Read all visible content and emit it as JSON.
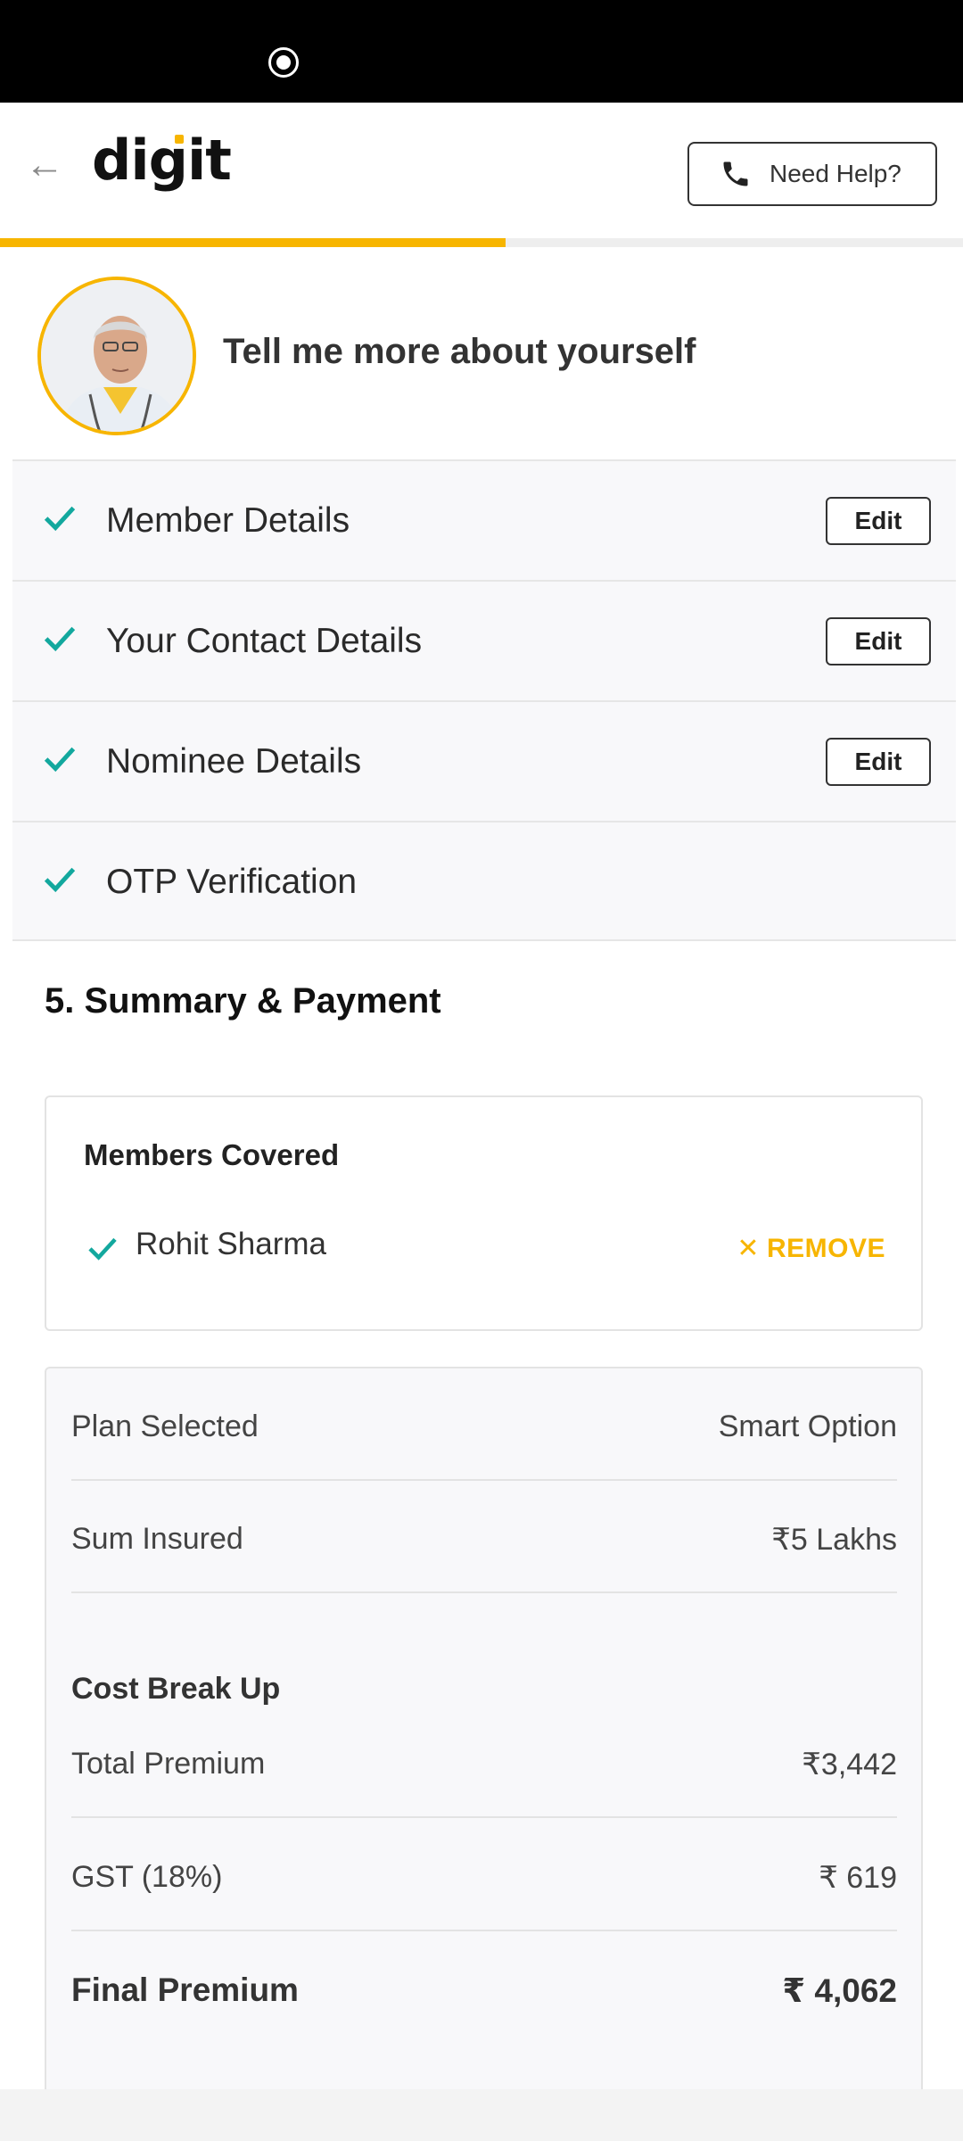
{
  "brand": {
    "logo_text": "digit",
    "accent_color": "#f7b500",
    "check_color": "#13a89e"
  },
  "header": {
    "back_icon": "arrow-left-icon",
    "help_label": "Need Help?",
    "help_icon": "phone-icon"
  },
  "progress": {
    "fraction": 0.525
  },
  "intro": {
    "text": "Tell me more about yourself",
    "avatar": "doctor-avatar"
  },
  "steps": [
    {
      "label": "Member Details",
      "edit_label": "Edit"
    },
    {
      "label": "Your Contact Details",
      "edit_label": "Edit"
    },
    {
      "label": "Nominee Details",
      "edit_label": "Edit"
    },
    {
      "label": "OTP Verification"
    }
  ],
  "summary_section": {
    "title": "5. Summary & Payment"
  },
  "members": {
    "title": "Members Covered",
    "items": [
      {
        "name": "Rohit Sharma",
        "remove_label": "REMOVE"
      }
    ]
  },
  "summary": {
    "plan_label": "Plan Selected",
    "plan_value": "Smart Option",
    "sum_label": "Sum Insured",
    "sum_value": "₹5 Lakhs",
    "cost_header": "Cost Break Up",
    "premium_label": "Total Premium",
    "premium_value": "₹3,442",
    "gst_label": "GST (18%)",
    "gst_value": "₹ 619",
    "final_label": "Final Premium",
    "final_value": "₹ 4,062"
  }
}
